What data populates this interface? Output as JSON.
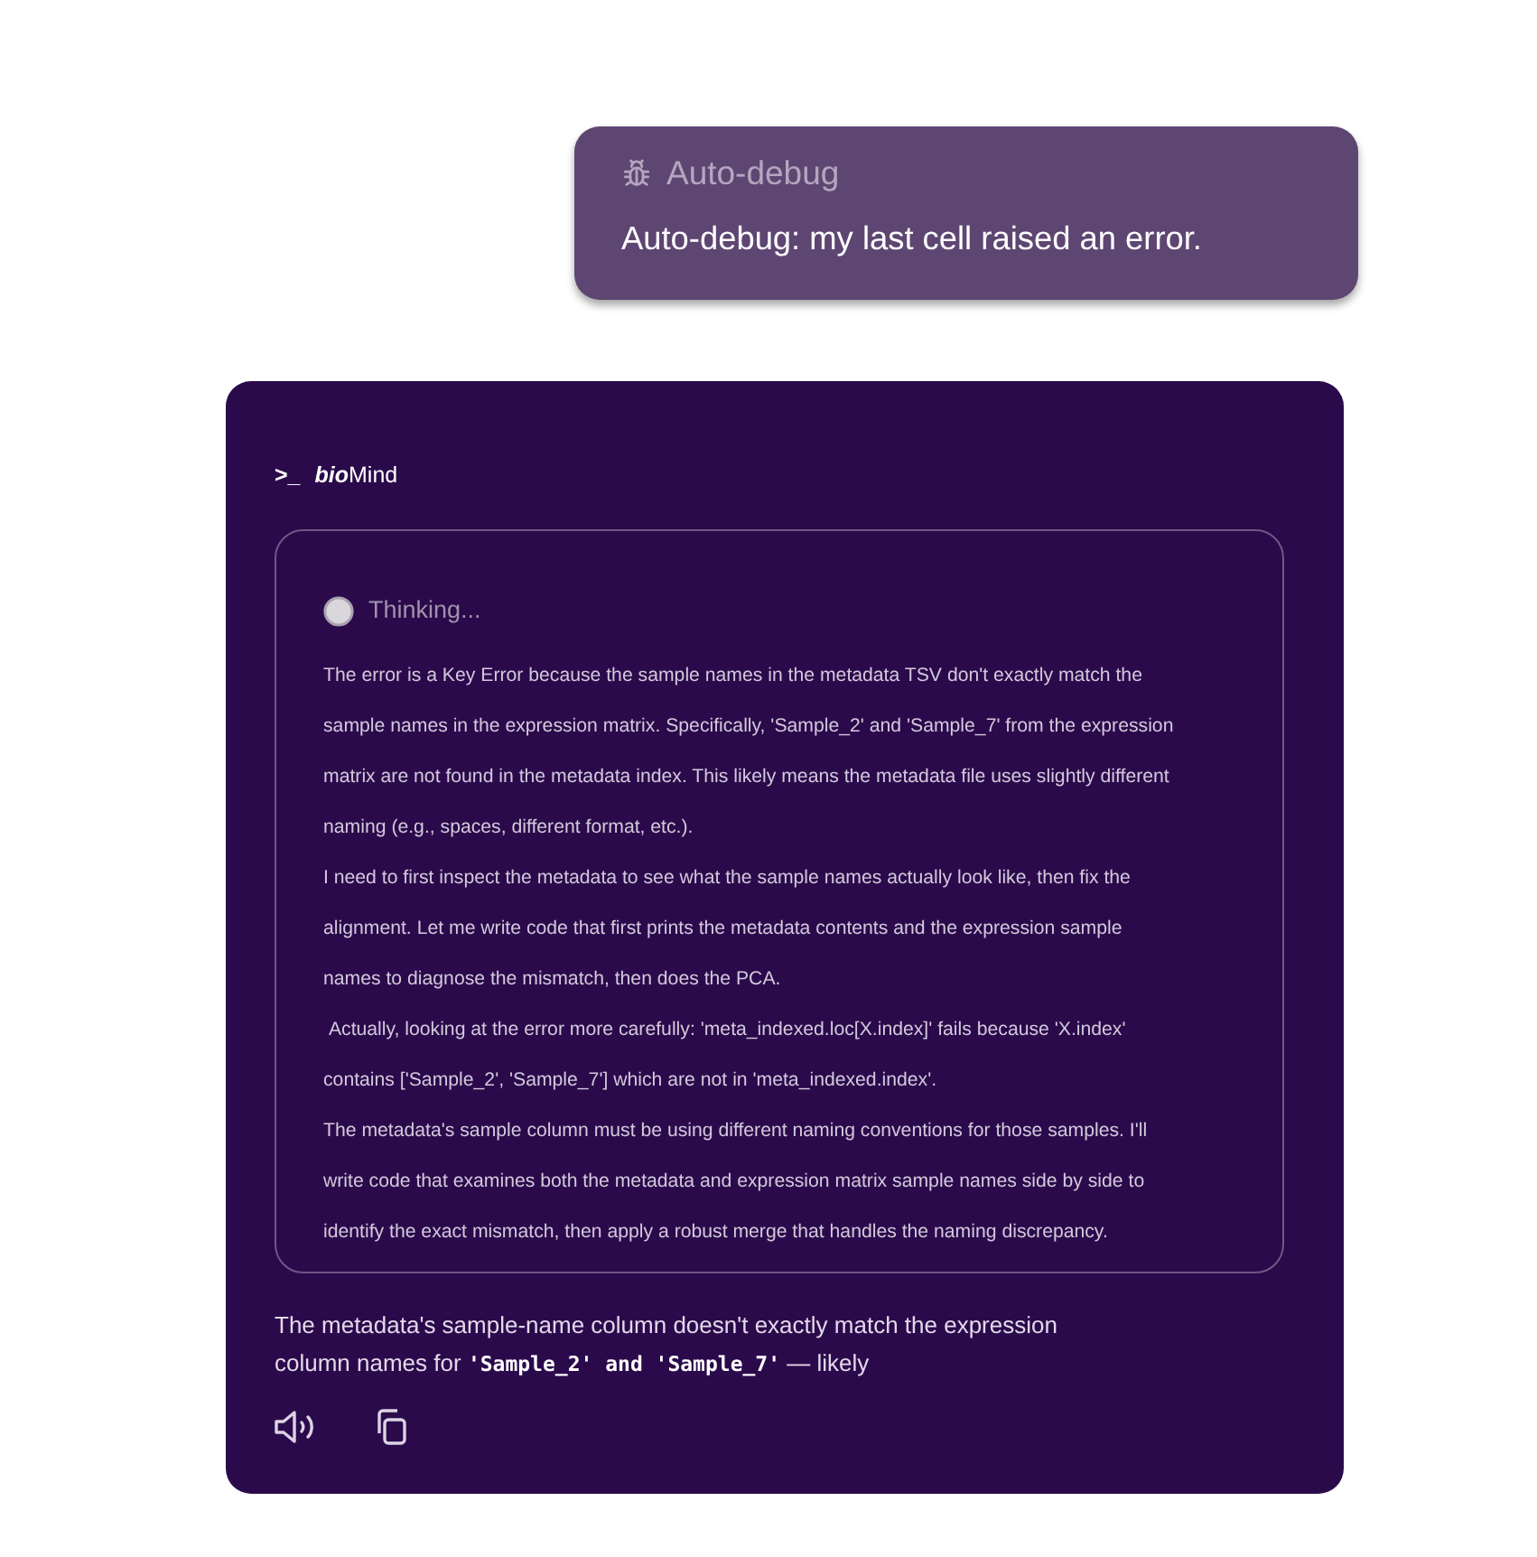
{
  "user_message": {
    "tag": "Auto-debug",
    "text": "Auto-debug: my last cell raised an error."
  },
  "assistant": {
    "prompt": ">_",
    "brand": "**bio**Mind",
    "thinking": {
      "status": "Thinking...",
      "paragraphs": [
        "The error is a Key Error because the sample names in the metadata TSV don't exactly match the sample names in the expression matrix. Specifically, 'Sample_2' and 'Sample_7' from the expression matrix are not found in the metadata index. This likely means the metadata file uses slightly different naming (e.g., spaces, different format, etc.).",
        "I need to first inspect the metadata to see what the sample names actually look like, then fix the alignment. Let me write code that first prints the metadata contents and the expression sample names to diagnose the mismatch, then does the PCA.",
        " Actually, looking at the error more carefully: 'meta_indexed.loc[X.index]' fails because 'X.index' contains ['Sample_2', 'Sample_7'] which are not in 'meta_indexed.index'.",
        "The metadata's sample column must be using different naming conventions for those samples. I'll write code that examines both the metadata and expression matrix sample names side by side to identify the exact mismatch, then apply a robust merge that handles the naming discrepancy."
      ]
    },
    "response": [
      {
        "kind": "text",
        "text": "The metadata's sample-name column doesn't exactly match the expression column names for "
      },
      {
        "kind": "code",
        "text": "'Sample_2' and 'Sample_7'"
      },
      {
        "kind": "text",
        "text": " — likely"
      }
    ],
    "actions": [
      {
        "kind": "speaker"
      },
      {
        "kind": "copy"
      }
    ]
  }
}
